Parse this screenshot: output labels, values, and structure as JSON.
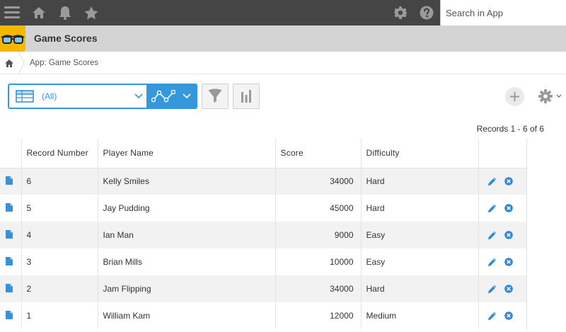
{
  "topbar": {
    "icons": [
      "menu-icon",
      "home-icon",
      "bell-icon",
      "star-icon",
      "gear-icon",
      "help-icon"
    ],
    "search": {
      "placeholder": "Search in App",
      "value": ""
    },
    "bg_color": "#454545"
  },
  "app": {
    "title": "Game Scores",
    "logo_icon": "glasses-icon",
    "logo_color": "#f5b800"
  },
  "breadcrumb": {
    "home_icon": "home-icon",
    "text": "App: Game Scores"
  },
  "toolbar": {
    "view_value": "(All)",
    "view_icon": "table-view-icon",
    "graph_icon": "graph-icon",
    "filter_icon": "filter-icon",
    "chart_icon": "bar-chart-icon",
    "add_icon": "plus-icon",
    "settings_icon": "gear-icon",
    "accent_color": "#3498db"
  },
  "records_summary": "Records 1 - 6 of 6",
  "table": {
    "columns": [
      "Record Number",
      "Player Name",
      "Score",
      "Difficulty"
    ],
    "rows": [
      {
        "record_number": "6",
        "player_name": "Kelly Smiles",
        "score": "34000",
        "difficulty": "Hard"
      },
      {
        "record_number": "5",
        "player_name": "Jay Pudding",
        "score": "45000",
        "difficulty": "Hard"
      },
      {
        "record_number": "4",
        "player_name": "Ian Man",
        "score": "9000",
        "difficulty": "Easy"
      },
      {
        "record_number": "3",
        "player_name": "Brian Mills",
        "score": "10000",
        "difficulty": "Easy"
      },
      {
        "record_number": "2",
        "player_name": "Jam Flipping",
        "score": "34000",
        "difficulty": "Hard"
      },
      {
        "record_number": "1",
        "player_name": "William Kam",
        "score": "12000",
        "difficulty": "Medium"
      }
    ],
    "row_icons": [
      "document-icon",
      "edit-icon",
      "delete-icon"
    ]
  }
}
